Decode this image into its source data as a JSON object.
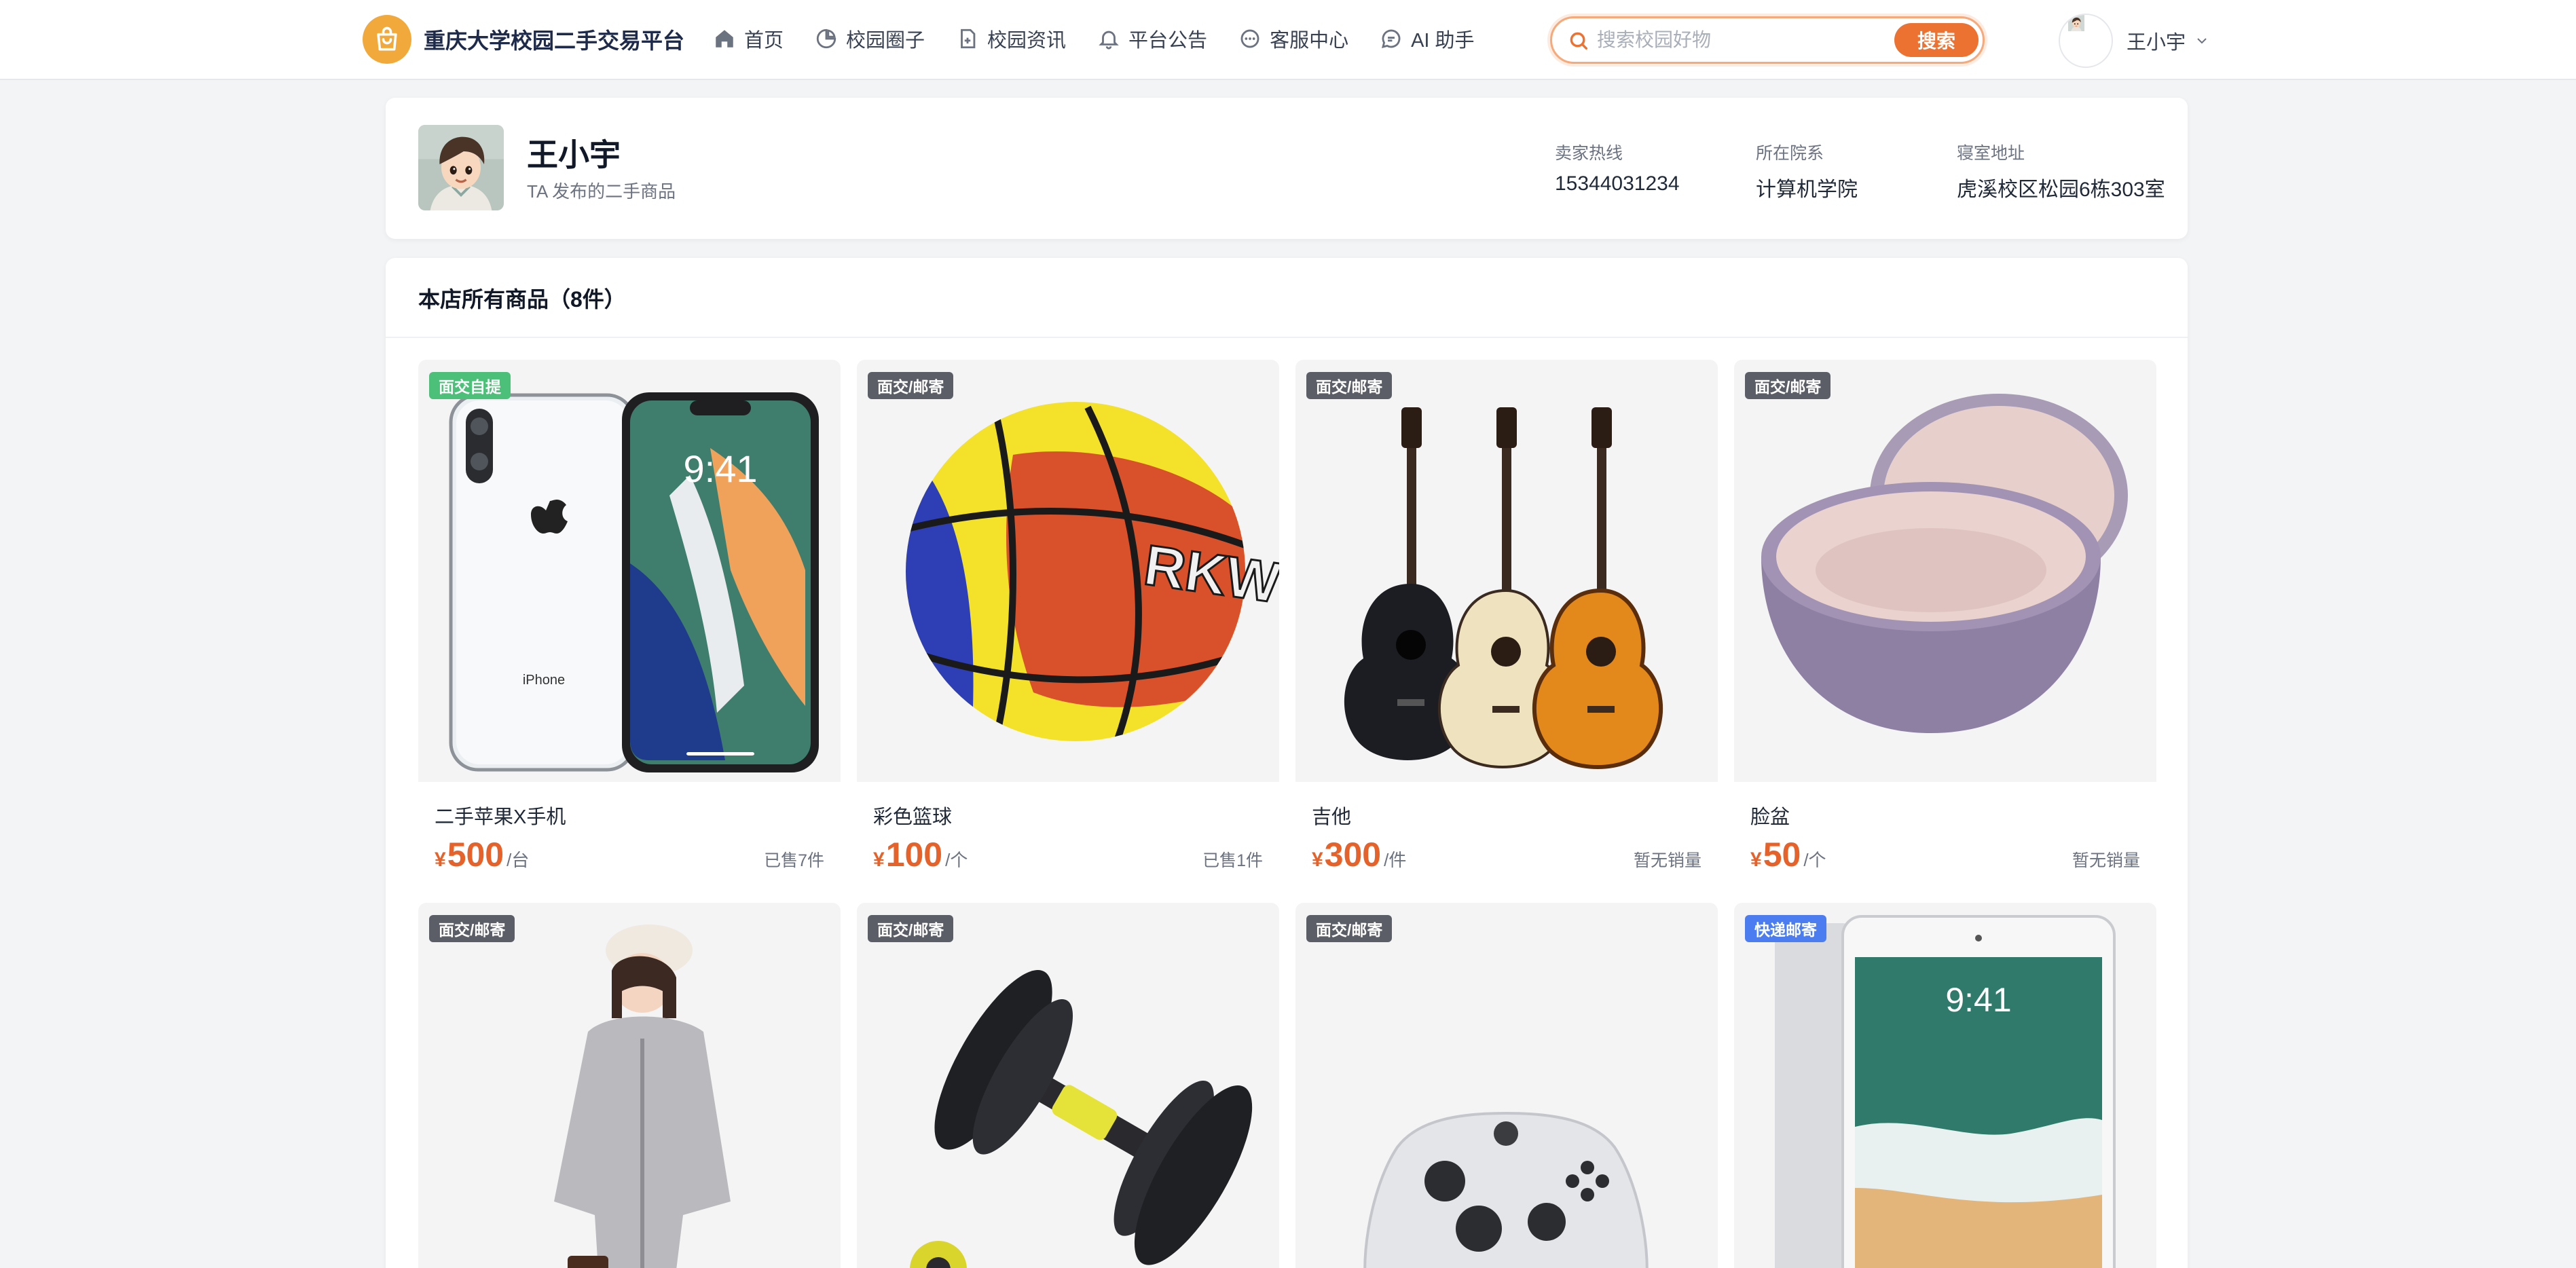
{
  "header": {
    "brand_name": "重庆大学校园二手交易平台",
    "nav": [
      {
        "label": "首页",
        "icon": "home-icon"
      },
      {
        "label": "校园圈子",
        "icon": "pie-chart-icon"
      },
      {
        "label": "校园资讯",
        "icon": "document-icon"
      },
      {
        "label": "平台公告",
        "icon": "bell-icon"
      },
      {
        "label": "客服中心",
        "icon": "chat-icon"
      },
      {
        "label": "AI 助手",
        "icon": "chat-bubble-icon"
      }
    ],
    "search": {
      "placeholder": "搜索校园好物",
      "button_label": "搜索"
    },
    "user_name": "王小宇"
  },
  "profile": {
    "name": "王小宇",
    "subtitle": "TA 发布的二手商品",
    "info": [
      {
        "label": "卖家热线",
        "value": "15344031234"
      },
      {
        "label": "所在院系",
        "value": "计算机学院"
      },
      {
        "label": "寝室地址",
        "value": "虎溪校区松园6栋303室"
      }
    ]
  },
  "goods": {
    "title": "本店所有商品（8件）",
    "items": [
      {
        "tag": "面交自提",
        "tag_color": "green",
        "name": "二手苹果X手机",
        "currency": "¥",
        "price": "500",
        "unit": "/台",
        "sales": "已售7件"
      },
      {
        "tag": "面交/邮寄",
        "tag_color": "dark",
        "name": "彩色篮球",
        "currency": "¥",
        "price": "100",
        "unit": "/个",
        "sales": "已售1件"
      },
      {
        "tag": "面交/邮寄",
        "tag_color": "dark",
        "name": "吉他",
        "currency": "¥",
        "price": "300",
        "unit": "/件",
        "sales": "暂无销量"
      },
      {
        "tag": "面交/邮寄",
        "tag_color": "dark",
        "name": "脸盆",
        "currency": "¥",
        "price": "50",
        "unit": "/个",
        "sales": "暂无销量"
      },
      {
        "tag": "面交/邮寄",
        "tag_color": "dark"
      },
      {
        "tag": "面交/邮寄",
        "tag_color": "dark"
      },
      {
        "tag": "面交/邮寄",
        "tag_color": "dark"
      },
      {
        "tag": "快递邮寄",
        "tag_color": "blue"
      }
    ]
  },
  "colors": {
    "accent": "#ec7232",
    "brand_badge": "#f2a93b",
    "price": "#e5632a",
    "tag_green": "#4cbf78",
    "tag_blue": "#4b7df0",
    "tag_dark": "#5b5e66"
  }
}
